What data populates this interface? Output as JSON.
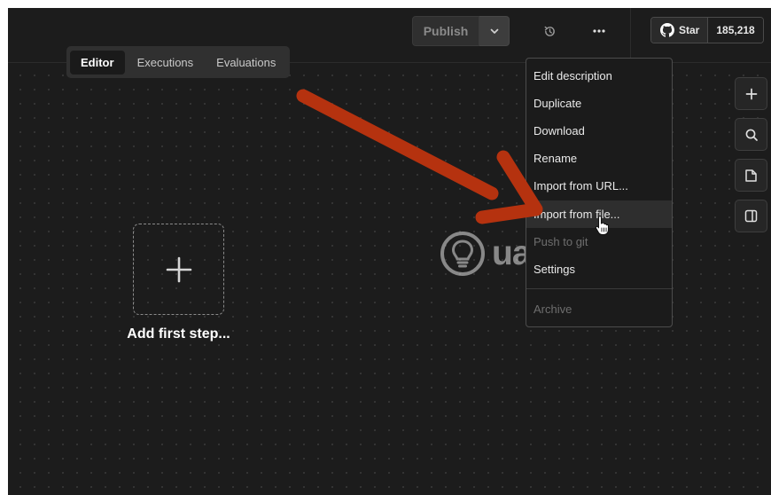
{
  "header": {
    "publish_label": "Publish",
    "github": {
      "star_label": "Star",
      "count": "185,218"
    }
  },
  "tabs": [
    {
      "label": "Editor",
      "active": true
    },
    {
      "label": "Executions",
      "active": false
    },
    {
      "label": "Evaluations",
      "active": false
    }
  ],
  "menu": {
    "items": [
      {
        "label": "Edit description",
        "state": "normal"
      },
      {
        "label": "Duplicate",
        "state": "normal"
      },
      {
        "label": "Download",
        "state": "normal"
      },
      {
        "label": "Rename",
        "state": "normal"
      },
      {
        "label": "Import from URL...",
        "state": "normal"
      },
      {
        "label": "Import from file...",
        "state": "hover"
      },
      {
        "label": "Push to git",
        "state": "disabled"
      },
      {
        "label": "Settings",
        "state": "normal"
      },
      {
        "label": "Archive",
        "state": "disabled"
      }
    ]
  },
  "canvas": {
    "add_step_label": "Add first step..."
  },
  "watermark": {
    "text": "uantrimang"
  },
  "icons": {
    "publish_caret": "chevron-down-icon",
    "history": "history-icon",
    "more": "more-dots-icon",
    "github": "github-icon",
    "rail": [
      "plus-icon",
      "search-icon",
      "sticky-note-icon",
      "panel-icon"
    ],
    "add_step": "plus-icon"
  },
  "colors": {
    "background": "#1c1c1c",
    "annotation_arrow": "#b5320f"
  }
}
